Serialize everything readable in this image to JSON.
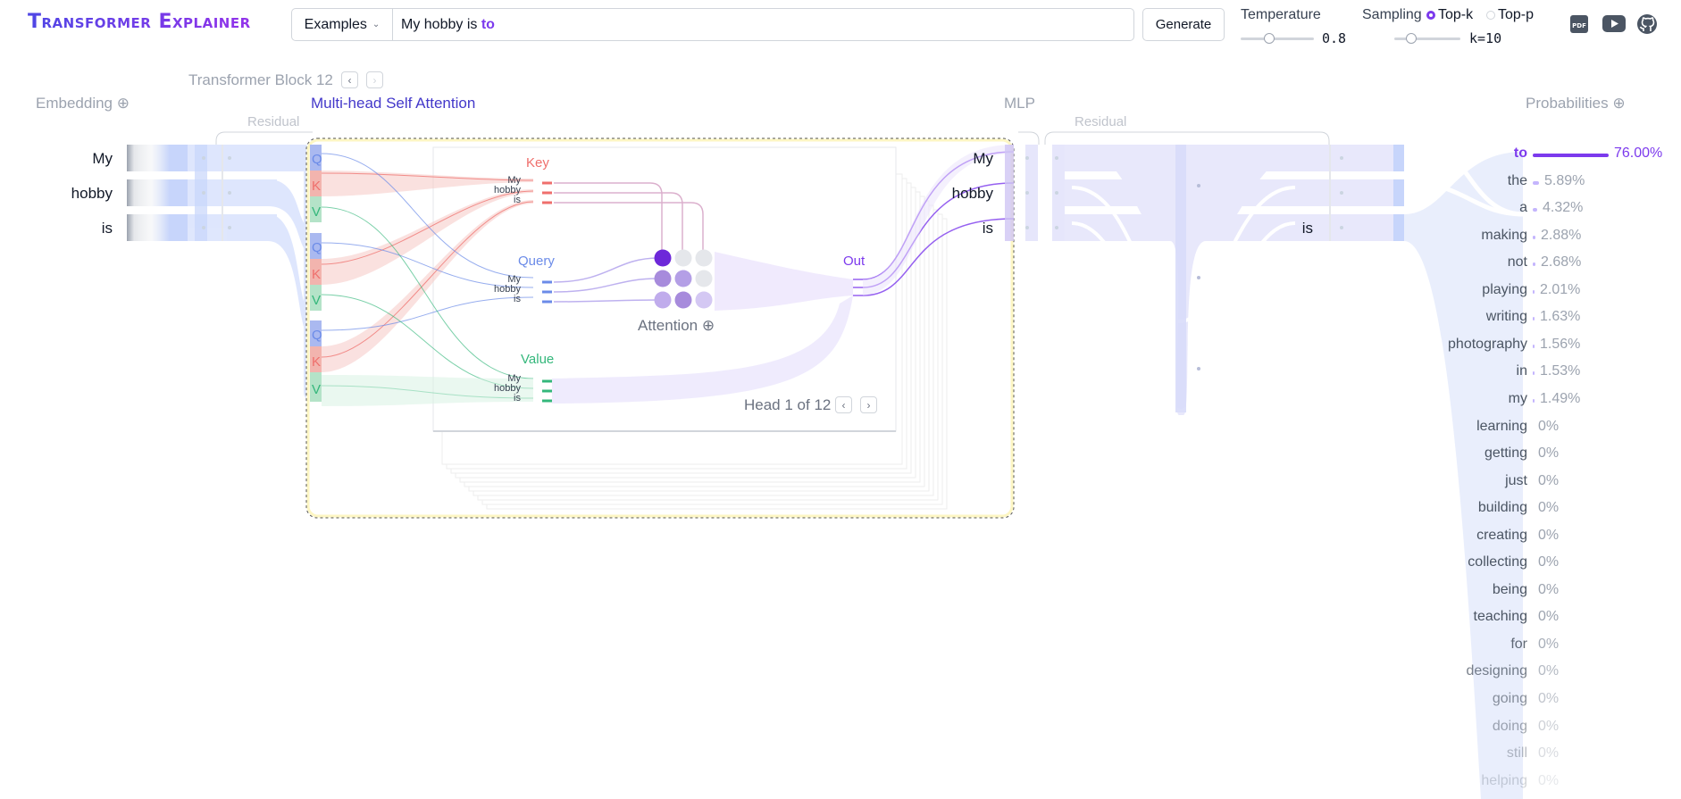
{
  "app": {
    "title": "Transformer Explainer"
  },
  "input": {
    "examples_label": "Examples",
    "prompt_text": "My hobby is",
    "prompt_next": "to"
  },
  "generate_label": "Generate",
  "temperature": {
    "label": "Temperature",
    "value": "0.8"
  },
  "sampling": {
    "label": "Sampling",
    "option_topk": "Top-k",
    "option_topp": "Top-p",
    "selected": "Top-k",
    "k_value": "k=10"
  },
  "toolbar": {
    "pdf_icon": "pdf-icon",
    "youtube_icon": "youtube-icon",
    "github_icon": "github-icon"
  },
  "block": {
    "title": "Transformer Block 12"
  },
  "sections": {
    "embedding": "Embedding",
    "mhsa": "Multi-head Self Attention",
    "mlp": "MLP",
    "probabilities": "Probabilities",
    "residual": "Residual"
  },
  "tokens": [
    "My",
    "hobby",
    "is"
  ],
  "qkv": {
    "q": "Q",
    "k": "K",
    "v": "V"
  },
  "attention": {
    "key": "Key",
    "query": "Query",
    "value": "Value",
    "out": "Out",
    "attention": "Attention",
    "head": "Head 1 of 12"
  },
  "mlp_token": "is",
  "colors": {
    "accent": "#7c3aed",
    "key": "#ef6f6c",
    "query": "#6b8be8",
    "value": "#34b77b",
    "embed": "#c7d5fb",
    "mlp": "#dcdcfb"
  },
  "probabilities": [
    {
      "token": "to",
      "value": "76.00%",
      "p": 0.76
    },
    {
      "token": "the",
      "value": "5.89%",
      "p": 0.0589
    },
    {
      "token": "a",
      "value": "4.32%",
      "p": 0.0432
    },
    {
      "token": "making",
      "value": "2.88%",
      "p": 0.0288
    },
    {
      "token": "not",
      "value": "2.68%",
      "p": 0.0268
    },
    {
      "token": "playing",
      "value": "2.01%",
      "p": 0.0201
    },
    {
      "token": "writing",
      "value": "1.63%",
      "p": 0.0163
    },
    {
      "token": "photography",
      "value": "1.56%",
      "p": 0.0156
    },
    {
      "token": "in",
      "value": "1.53%",
      "p": 0.0153
    },
    {
      "token": "my",
      "value": "1.49%",
      "p": 0.0149
    },
    {
      "token": "learning",
      "value": "0%",
      "p": 0
    },
    {
      "token": "getting",
      "value": "0%",
      "p": 0
    },
    {
      "token": "just",
      "value": "0%",
      "p": 0
    },
    {
      "token": "building",
      "value": "0%",
      "p": 0
    },
    {
      "token": "creating",
      "value": "0%",
      "p": 0
    },
    {
      "token": "collecting",
      "value": "0%",
      "p": 0
    },
    {
      "token": "being",
      "value": "0%",
      "p": 0
    },
    {
      "token": "teaching",
      "value": "0%",
      "p": 0
    },
    {
      "token": "for",
      "value": "0%",
      "p": 0
    },
    {
      "token": "designing",
      "value": "0%",
      "p": 0
    },
    {
      "token": "going",
      "value": "0%",
      "p": 0
    },
    {
      "token": "doing",
      "value": "0%",
      "p": 0
    },
    {
      "token": "still",
      "value": "0%",
      "p": 0
    },
    {
      "token": "helping",
      "value": "0%",
      "p": 0
    }
  ]
}
